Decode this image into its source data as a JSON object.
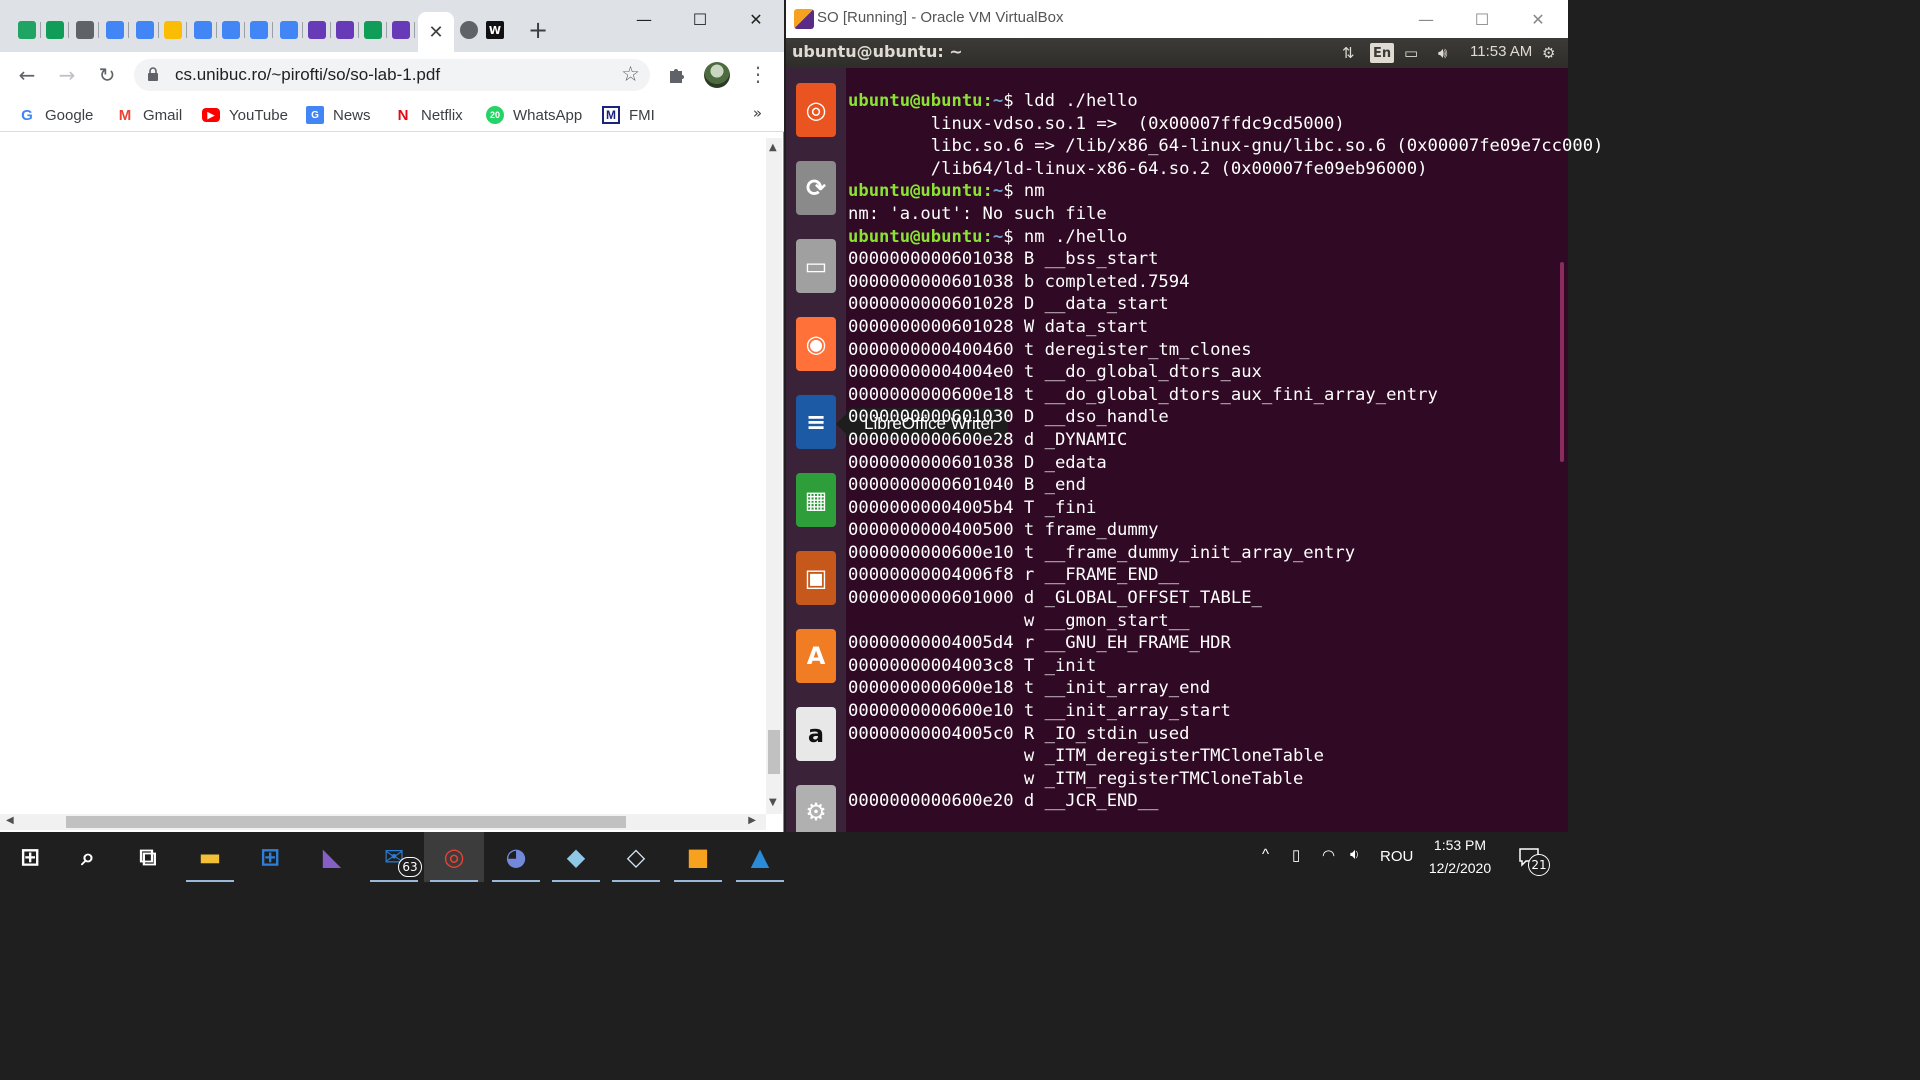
{
  "browser": {
    "tabs": [
      {
        "icon": "google-drive-icon",
        "color": "#1fa463"
      },
      {
        "icon": "google-sheets-icon",
        "color": "#0f9d58"
      },
      {
        "icon": "link-icon",
        "color": "#5f6368"
      },
      {
        "icon": "google-icon",
        "color": "#4285f4"
      },
      {
        "icon": "google-docs-icon",
        "color": "#4285f4"
      },
      {
        "icon": "google-drive-icon",
        "color": "#fbbc04"
      },
      {
        "icon": "google-docs-icon",
        "color": "#4285f4"
      },
      {
        "icon": "google-docs-icon",
        "color": "#4285f4"
      },
      {
        "icon": "google-docs-icon",
        "color": "#4285f4"
      },
      {
        "icon": "google-docs-icon",
        "color": "#4285f4"
      },
      {
        "icon": "google-forms-icon",
        "color": "#673ab7"
      },
      {
        "icon": "google-forms-icon",
        "color": "#673ab7"
      },
      {
        "icon": "google-sheets-grid-icon",
        "color": "#0f9d58"
      },
      {
        "icon": "google-forms-icon",
        "color": "#673ab7"
      }
    ],
    "active_tab_close": "✕",
    "extra_tabs": [
      {
        "icon": "globe-icon",
        "color": "#5f6368"
      },
      {
        "icon": "wikipedia-icon",
        "color": "#111111",
        "glyph": "W"
      }
    ],
    "new_tab": "+",
    "url": "cs.unibuc.ro/~pirofti/so/so-lab-1.pdf",
    "bookmarks": [
      {
        "label": "Google",
        "icon": "google-icon",
        "glyph": "G",
        "color": "#4285f4"
      },
      {
        "label": "Gmail",
        "icon": "gmail-icon",
        "glyph": "M",
        "color": "#ea4335"
      },
      {
        "label": "YouTube",
        "icon": "youtube-icon",
        "glyph": "▶",
        "color": "#ff0000"
      },
      {
        "label": "News",
        "icon": "news-icon",
        "glyph": "G",
        "color": "#4285f4"
      },
      {
        "label": "Netflix",
        "icon": "netflix-icon",
        "glyph": "N",
        "color": "#e50914"
      },
      {
        "label": "WhatsApp",
        "icon": "whatsapp-icon",
        "glyph": "20",
        "color": "#25d366"
      },
      {
        "label": "FMI",
        "icon": "fmi-icon",
        "glyph": "M",
        "color": "#1a237e"
      }
    ],
    "bookmarks_more": "»",
    "vscroll_thumb_position": 0.9,
    "hscroll_thumb_position": 0.0
  },
  "vbox": {
    "title": "SO [Running] - Oracle VM VirtualBox",
    "panel": {
      "host": "ubuntu@ubuntu: ~",
      "keyboard": "En",
      "clock": "11:53 AM"
    },
    "launcher": [
      {
        "name": "ubuntu-dash-icon",
        "color": "#e95420",
        "glyph": "◎"
      },
      {
        "name": "software-updater-icon",
        "color": "#8a8a8a",
        "glyph": "⟳"
      },
      {
        "name": "files-icon",
        "color": "#a0a0a0",
        "glyph": "▭"
      },
      {
        "name": "firefox-icon",
        "color": "#ff7139",
        "glyph": "◉"
      },
      {
        "name": "libreoffice-writer-icon",
        "color": "#1c5aa6",
        "glyph": "≡"
      },
      {
        "name": "libreoffice-calc-icon",
        "color": "#2e9e3a",
        "glyph": "▦"
      },
      {
        "name": "libreoffice-impress-icon",
        "color": "#c7581c",
        "glyph": "▣"
      },
      {
        "name": "ubuntu-software-icon",
        "color": "#f07d24",
        "glyph": "A"
      },
      {
        "name": "amazon-icon",
        "color": "#e8e8e8",
        "glyph": "a"
      },
      {
        "name": "system-settings-icon",
        "color": "#b0b0b0",
        "glyph": "⚙"
      }
    ],
    "tooltip": "LibreOffice Writer",
    "terminal_lines": [
      {
        "prompt": "ubuntu@ubuntu:",
        "path": "~",
        "text": "$ ldd ./hello"
      },
      {
        "text": "\tlinux-vdso.so.1 =>  (0x00007ffdc9cd5000)"
      },
      {
        "text": "\tlibc.so.6 => /lib/x86_64-linux-gnu/libc.so.6 (0x00007fe09e7cc000)"
      },
      {
        "text": "\t/lib64/ld-linux-x86-64.so.2 (0x00007fe09eb96000)"
      },
      {
        "prompt": "ubuntu@ubuntu:",
        "path": "~",
        "text": "$ nm"
      },
      {
        "text": "nm: 'a.out': No such file"
      },
      {
        "prompt": "ubuntu@ubuntu:",
        "path": "~",
        "text": "$ nm ./hello"
      },
      {
        "text": "0000000000601038 B __bss_start"
      },
      {
        "text": "0000000000601038 b completed.7594"
      },
      {
        "text": "0000000000601028 D __data_start"
      },
      {
        "text": "0000000000601028 W data_start"
      },
      {
        "text": "0000000000400460 t deregister_tm_clones"
      },
      {
        "text": "00000000004004e0 t __do_global_dtors_aux"
      },
      {
        "text": "0000000000600e18 t __do_global_dtors_aux_fini_array_entry"
      },
      {
        "text": "0000000000601030 D __dso_handle"
      },
      {
        "text": "0000000000600e28 d _DYNAMIC"
      },
      {
        "text": "0000000000601038 D _edata"
      },
      {
        "text": "0000000000601040 B _end"
      },
      {
        "text": "00000000004005b4 T _fini"
      },
      {
        "text": "0000000000400500 t frame_dummy"
      },
      {
        "text": "0000000000600e10 t __frame_dummy_init_array_entry"
      },
      {
        "text": "00000000004006f8 r __FRAME_END__"
      },
      {
        "text": "0000000000601000 d _GLOBAL_OFFSET_TABLE_"
      },
      {
        "text": "                 w __gmon_start__"
      },
      {
        "text": "00000000004005d4 r __GNU_EH_FRAME_HDR"
      },
      {
        "text": "00000000004003c8 T _init"
      },
      {
        "text": "0000000000600e18 t __init_array_end"
      },
      {
        "text": "0000000000600e10 t __init_array_start"
      },
      {
        "text": "00000000004005c0 R _IO_stdin_used"
      },
      {
        "text": "                 w _ITM_deregisterTMCloneTable"
      },
      {
        "text": "                 w _ITM_registerTMCloneTable"
      },
      {
        "text": "0000000000600e20 d __JCR_END__"
      }
    ]
  },
  "taskbar": {
    "apps": [
      {
        "name": "start-button",
        "glyph": "⊞",
        "color": "#ffffff"
      },
      {
        "name": "search-icon",
        "glyph": "⌕",
        "color": "#ffffff"
      },
      {
        "name": "task-view-icon",
        "glyph": "⧉",
        "color": "#ffffff"
      },
      {
        "name": "file-explorer-icon",
        "glyph": "▬",
        "color": "#f2c037"
      },
      {
        "name": "microsoft-store-icon",
        "glyph": "⊞",
        "color": "#2f7fd6"
      },
      {
        "name": "visual-studio-icon",
        "glyph": "◣",
        "color": "#865fc5"
      },
      {
        "name": "mail-icon",
        "glyph": "✉",
        "color": "#2b7cd3"
      },
      {
        "name": "chrome-icon",
        "glyph": "◎",
        "color": "#ea4335"
      },
      {
        "name": "discord-icon",
        "glyph": "◕",
        "color": "#7289da"
      },
      {
        "name": "notepad-icon",
        "glyph": "◆",
        "color": "#8fc8e6"
      },
      {
        "name": "virtualbox-cube-icon",
        "glyph": "◇",
        "color": "#d7e6f5"
      },
      {
        "name": "virtualbox-icon",
        "glyph": "■",
        "color": "#f6a21e"
      },
      {
        "name": "photos-icon",
        "glyph": "▲",
        "color": "#2b8bd6"
      }
    ],
    "mail_badge": "63",
    "tray": {
      "chevron": "^",
      "language": "ROU",
      "time": "1:53 PM",
      "date": "12/2/2020",
      "notifications": "21"
    }
  }
}
